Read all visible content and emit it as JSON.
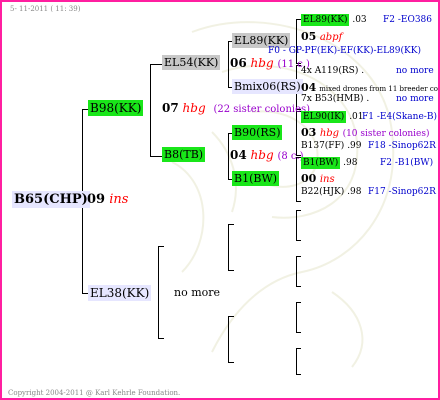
{
  "header": {
    "date": "5- 11-2011 ( 11: 39)"
  },
  "footer": {
    "copyright": "Copyright 2004-2011 @ Karl Kehrle Foundation."
  },
  "root": {
    "id": "B65(CHP)",
    "year": "09",
    "origin": "ins"
  },
  "gen1": {
    "mother": {
      "id": "B98(KK)",
      "year": "07",
      "origin": "hbg",
      "note": "(22 sister colonies)"
    },
    "father": {
      "id": "EL38(KK)",
      "note": "no more"
    }
  },
  "gen2": {
    "mm": {
      "id": "EL54(KK)",
      "year": "06",
      "origin": "hbg",
      "note": "(11 c.)"
    },
    "mf": {
      "id": "B8(TB)",
      "year": "04",
      "origin": "hbg",
      "note": "(8 c.)"
    }
  },
  "gen3": {
    "mmm": {
      "id": "EL89(KK)"
    },
    "mmf": {
      "id": "Bmix06(RS)"
    },
    "mfm": {
      "id": "B90(RS)"
    },
    "mff": {
      "id": "B1(BW)"
    }
  },
  "gen4": {
    "r1": {
      "id": "EL89(KK)",
      "year": ".03",
      "ped": "F2 -EO386"
    },
    "r2": {
      "year": "05",
      "origin": "abpf"
    },
    "r3": {
      "overlap": "F0 - GP-PF(EK)-EF(KK)-EL89(KK)"
    },
    "r4": {
      "prefix": "4x",
      "id": "A119(RS)",
      "year": ".",
      "note": "no more"
    },
    "r5": {
      "year": "04",
      "note": "mixed drones from 11 breeder colonies"
    },
    "r6": {
      "prefix": "7x",
      "id": "B53(HMB)",
      "year": ".",
      "note": "no more"
    },
    "r7": {
      "id": "EL90(IK)",
      "year": ".01",
      "ped": "F1 -E4(Skane-B)"
    },
    "r8": {
      "year": "03",
      "origin": "hbg",
      "note": "(10 sister colonies)"
    },
    "r9": {
      "id": "B137(FF)",
      "year": ".99",
      "ped": "F18 -Sinop62R"
    },
    "r10": {
      "id": "B1(BW)",
      "year": ".98",
      "ped": "F2 -B1(BW)"
    },
    "r11": {
      "year": "00",
      "origin": "ins"
    },
    "r12": {
      "id": "B22(HJK)",
      "year": ".98",
      "ped": "F17 -Sinop62R"
    }
  },
  "colors": {
    "frame": "#ff1fa0",
    "highlight_green": "#19e619",
    "highlight_grey": "#c8c8c8",
    "origin_red": "#ff0000",
    "note_purple": "#9900cc",
    "pedigree_blue": "#0000cc"
  }
}
